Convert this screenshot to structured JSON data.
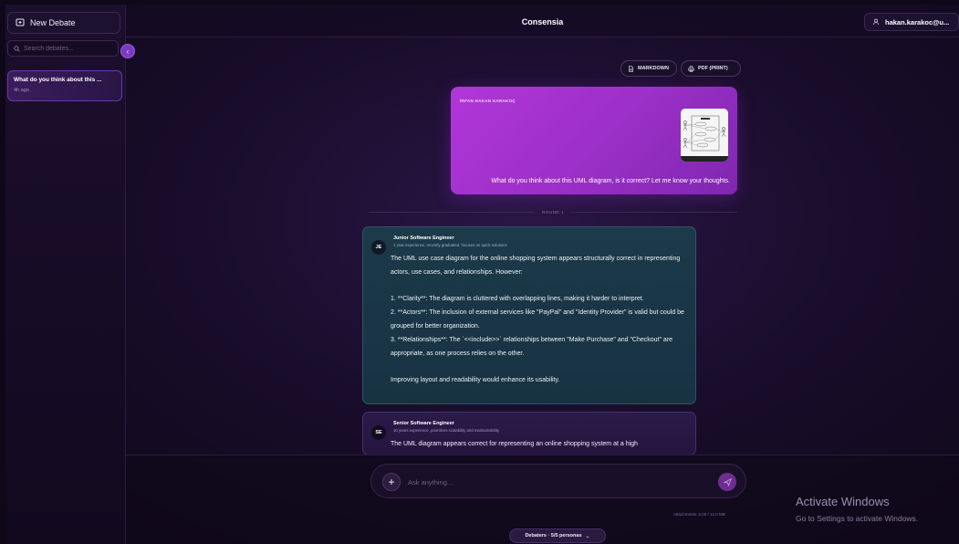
{
  "sidebar": {
    "new_debate_label": "New Debate",
    "search_placeholder": "Search debates...",
    "history": [
      {
        "title": "What do you think about this ...",
        "time": "4h ago"
      }
    ]
  },
  "header": {
    "title": "Consensia",
    "user": "hakan.karakoc@u..."
  },
  "export": {
    "markdown_label": "MARKDOWN",
    "pdf_label": "PDF (PRINT)"
  },
  "user_message": {
    "author": "İRFAN HAKAN KARAKOÇ",
    "text": "What do you think about this UML diagram, is it correct? Let me know your thoughts.",
    "attachment_icon": "uml-diagram-thumbnail"
  },
  "round_label": "ROUND 1",
  "agents": [
    {
      "initials": "JE",
      "name": "Junior Software Engineer",
      "desc": "1 year experience, recently graduated, focuses on quick solutions",
      "text": "The UML use case diagram for the online shopping system appears structurally correct in representing actors, use cases, and relationships. However:\n\n1. **Clarity**: The diagram is cluttered with overlapping lines, making it harder to interpret.\n2. **Actors**: The inclusion of external services like \"PayPal\" and \"Identity Provider\" is valid but could be grouped for better organization.\n3. **Relationships**: The `<<include>>` relationships between \"Make Purchase\" and \"Checkout\" are appropriate, as one process relies on the other.\n\nImproving layout and readability would enhance its usability."
    },
    {
      "initials": "SE",
      "name": "Senior Software Engineer",
      "desc": "10 years experience, prioritizes scalability and maintainability",
      "text": "The UML diagram appears correct for representing an online shopping system at a high"
    }
  ],
  "composer": {
    "placeholder": "Ask anything...",
    "attachments": "Attachments: 0.00 / 12.0 MB",
    "debaters_label": "Debaters · 5/5 personas"
  },
  "watermark": {
    "title": "Activate Windows",
    "subtitle": "Go to Settings to activate Windows."
  },
  "colors": {
    "accent": "#9d3fd0",
    "background": "#190d2b",
    "junior_card": "#1c3a4a",
    "senior_card": "#2b1a4a"
  }
}
